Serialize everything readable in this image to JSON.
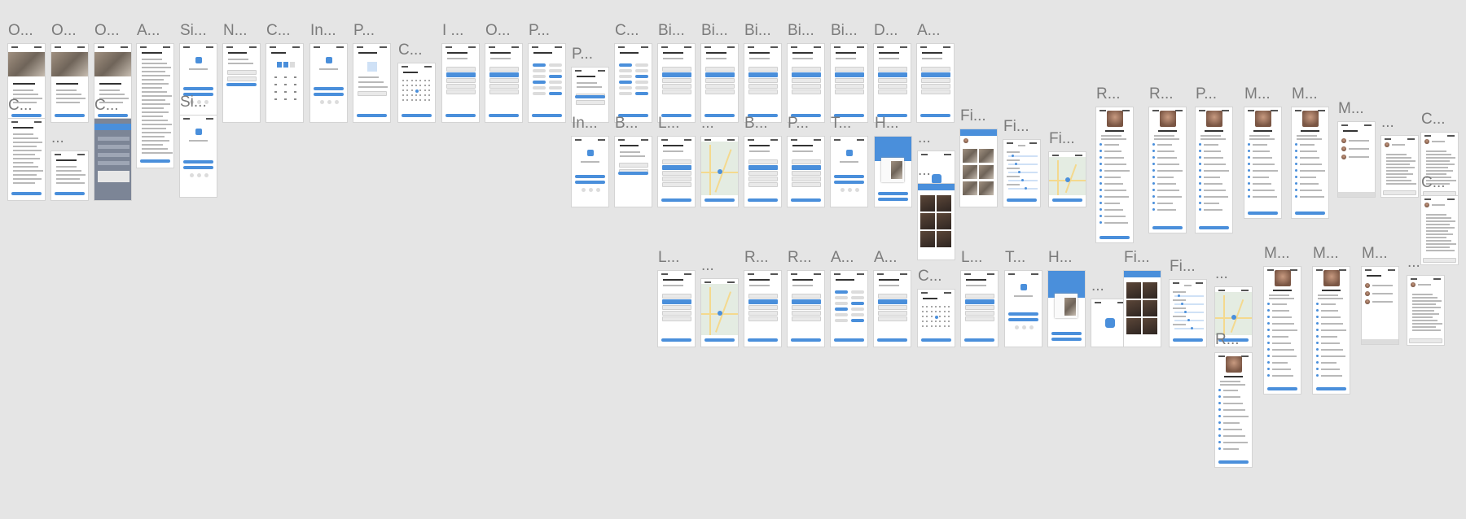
{
  "app": {
    "description_free": true
  },
  "colors": {
    "canvas_background": "#e5e5e5",
    "frame_label": "#7b7b7b",
    "phone_background": "#ffffff",
    "accent_blue": "#4a8fdb",
    "light_blue": "#cfe1f6"
  },
  "frames": [
    {
      "label": "O..."
    },
    {
      "label": "O..."
    },
    {
      "label": "O..."
    },
    {
      "label": "A..."
    },
    {
      "label": "Si..."
    },
    {
      "label": "N..."
    },
    {
      "label": "C..."
    },
    {
      "label": "In..."
    },
    {
      "label": "P..."
    },
    {
      "label": "C..."
    },
    {
      "label": "I ..."
    },
    {
      "label": "O..."
    },
    {
      "label": "P..."
    },
    {
      "label": "P..."
    },
    {
      "label": "C..."
    },
    {
      "label": "Bi..."
    },
    {
      "label": "Bi..."
    },
    {
      "label": "Bi..."
    },
    {
      "label": "Bi..."
    },
    {
      "label": "Bi..."
    },
    {
      "label": "D..."
    },
    {
      "label": "A..."
    },
    {
      "label": "C..."
    },
    {
      "label": "..."
    },
    {
      "label": "C..."
    },
    {
      "label": "Si..."
    },
    {
      "label": "In..."
    },
    {
      "label": "B..."
    },
    {
      "label": "L..."
    },
    {
      "label": "..."
    },
    {
      "label": "B..."
    },
    {
      "label": "P..."
    },
    {
      "label": "T..."
    },
    {
      "label": "H..."
    },
    {
      "label": "..."
    },
    {
      "label": "Fi..."
    },
    {
      "label": "Fi..."
    },
    {
      "label": "Fi..."
    },
    {
      "label": "..."
    },
    {
      "label": "R..."
    },
    {
      "label": "R..."
    },
    {
      "label": "P..."
    },
    {
      "label": "M..."
    },
    {
      "label": "M..."
    },
    {
      "label": "M..."
    },
    {
      "label": "..."
    },
    {
      "label": "C..."
    },
    {
      "label": "C..."
    },
    {
      "label": "L..."
    },
    {
      "label": "..."
    },
    {
      "label": "R..."
    },
    {
      "label": "R..."
    },
    {
      "label": "A..."
    },
    {
      "label": "A..."
    },
    {
      "label": "C..."
    },
    {
      "label": "L..."
    },
    {
      "label": "T..."
    },
    {
      "label": "H..."
    },
    {
      "label": "..."
    },
    {
      "label": "Fi..."
    },
    {
      "label": "Fi..."
    },
    {
      "label": "..."
    },
    {
      "label": "R..."
    },
    {
      "label": "M..."
    },
    {
      "label": "M..."
    },
    {
      "label": "M..."
    },
    {
      "label": "..."
    }
  ]
}
